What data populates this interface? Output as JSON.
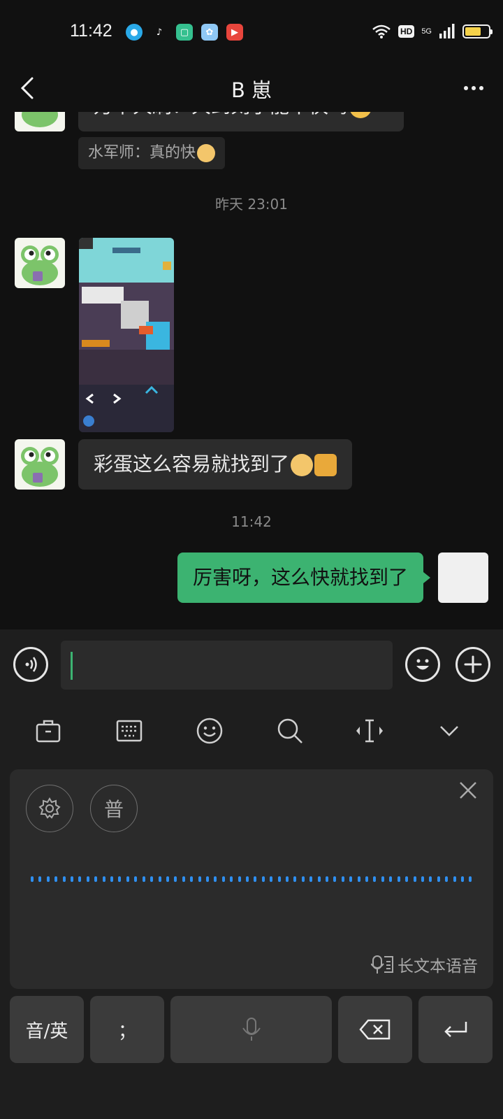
{
  "status_bar": {
    "time": "11:42",
    "apps": [
      "qq-icon",
      "tiktok-icon",
      "app-green-icon",
      "app-rabbit-icon",
      "app-video-icon"
    ],
    "hd": "HD",
    "network": "5G",
    "battery_level": 0.7
  },
  "header": {
    "title": "B 崽"
  },
  "messages": {
    "partial_text": "万卡大刷！大到刻子能不快吗",
    "quote_text": "水军师：真的快",
    "timestamp_1": "昨天 23:01",
    "received_text": "彩蛋这么容易就找到了",
    "timestamp_2": "11:42",
    "sent_text": "厉害呀，这么快就找到了"
  },
  "keyboard": {
    "voice_mode_label": "普",
    "long_voice_label": "长文本语音",
    "keys": {
      "lang_switch": "音/英",
      "semicolon": "；"
    }
  },
  "colors": {
    "background": "#111111",
    "bubble_received": "#2c2c2c",
    "bubble_sent": "#3cb371",
    "wave": "#2f8ff0",
    "battery": "#f5d24a"
  }
}
